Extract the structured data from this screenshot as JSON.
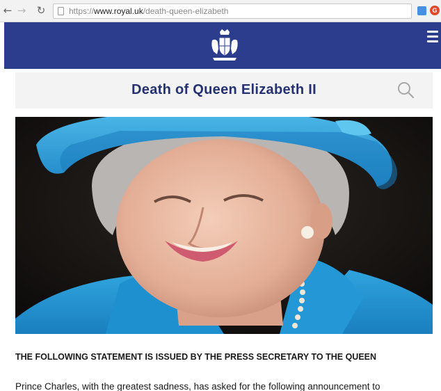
{
  "browser": {
    "url_prefix": "https://",
    "url_domain": "www.royal.uk",
    "url_path": "/death-queen-elizabeth",
    "ext_badge": "G"
  },
  "header": {
    "crest_icon": "royal-coat-of-arms-icon",
    "menu_icon": "hamburger-menu-icon",
    "background_color": "#2b3d8c"
  },
  "title_bar": {
    "title": "Death of Queen Elizabeth II",
    "search_icon": "search-icon"
  },
  "hero": {
    "image": "portrait-photo"
  },
  "article": {
    "heading": "THE FOLLOWING STATEMENT IS ISSUED BY THE PRESS SECRETARY TO THE QUEEN",
    "first_line": "Prince Charles, with the greatest sadness, has asked for the following announcement to"
  }
}
